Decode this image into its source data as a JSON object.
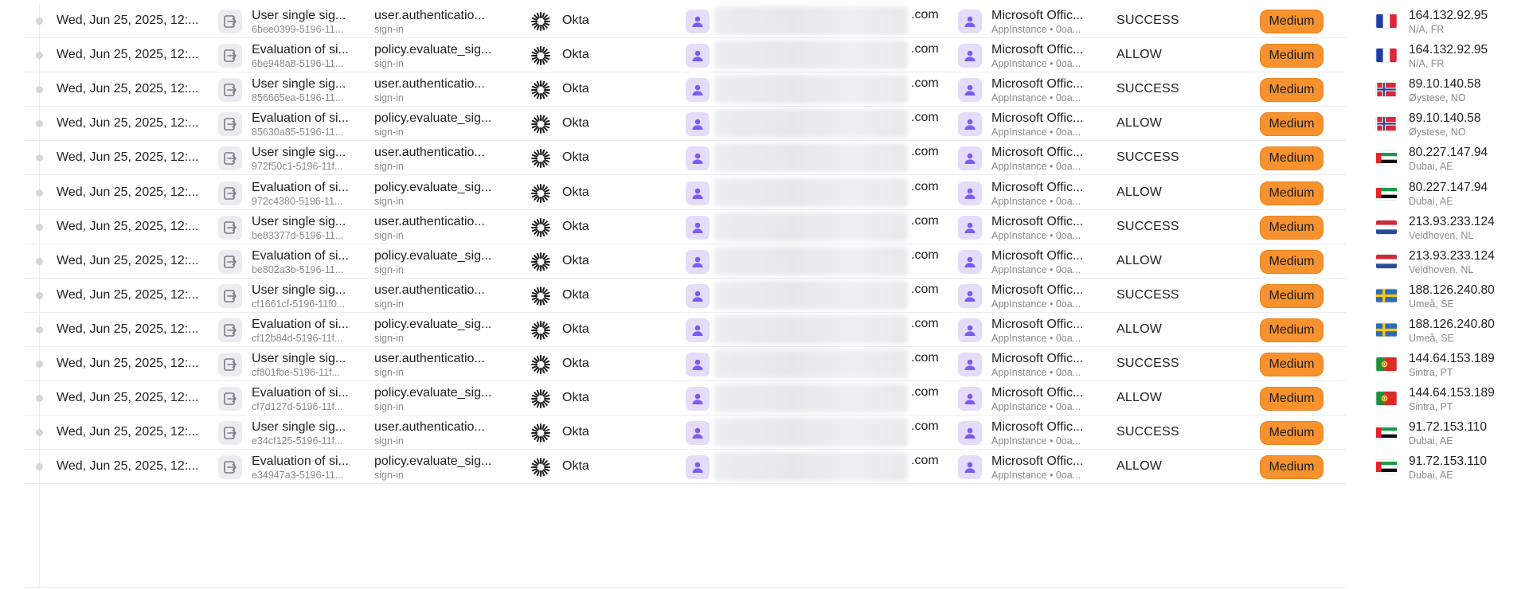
{
  "rows": [
    {
      "date": "Wed, Jun 25, 2025, 12:...",
      "event": "User single sig...",
      "event_id": "6bee0399-5196-11...",
      "type": "user.authenticatio...",
      "type_sub": "sign-in",
      "source": "Okta",
      "email_suffix": ".com",
      "app": "Microsoft Offic...",
      "app_sub": "AppInstance • 0oa...",
      "result": "SUCCESS",
      "severity": "Medium",
      "flag": "FR",
      "ip": "164.132.92.95",
      "location": "N/A, FR"
    },
    {
      "date": "Wed, Jun 25, 2025, 12:...",
      "event": "Evaluation of si...",
      "event_id": "6be948a8-5196-11...",
      "type": "policy.evaluate_sig...",
      "type_sub": "sign-in",
      "source": "Okta",
      "email_suffix": ".com",
      "app": "Microsoft Offic...",
      "app_sub": "AppInstance • 0oa...",
      "result": "ALLOW",
      "severity": "Medium",
      "flag": "FR",
      "ip": "164.132.92.95",
      "location": "N/A, FR"
    },
    {
      "date": "Wed, Jun 25, 2025, 12:...",
      "event": "User single sig...",
      "event_id": "856665ea-5196-11...",
      "type": "user.authenticatio...",
      "type_sub": "sign-in",
      "source": "Okta",
      "email_suffix": ".com",
      "app": "Microsoft Offic...",
      "app_sub": "AppInstance • 0oa...",
      "result": "SUCCESS",
      "severity": "Medium",
      "flag": "NO",
      "ip": "89.10.140.58",
      "location": "Øystese, NO"
    },
    {
      "date": "Wed, Jun 25, 2025, 12:...",
      "event": "Evaluation of si...",
      "event_id": "85630a85-5196-11...",
      "type": "policy.evaluate_sig...",
      "type_sub": "sign-in",
      "source": "Okta",
      "email_suffix": ".com",
      "app": "Microsoft Offic...",
      "app_sub": "AppInstance • 0oa...",
      "result": "ALLOW",
      "severity": "Medium",
      "flag": "NO",
      "ip": "89.10.140.58",
      "location": "Øystese, NO"
    },
    {
      "date": "Wed, Jun 25, 2025, 12:...",
      "event": "User single sig...",
      "event_id": "972f50c1-5196-11f...",
      "type": "user.authenticatio...",
      "type_sub": "sign-in",
      "source": "Okta",
      "email_suffix": ".com",
      "app": "Microsoft Offic...",
      "app_sub": "AppInstance • 0oa...",
      "result": "SUCCESS",
      "severity": "Medium",
      "flag": "AE",
      "ip": "80.227.147.94",
      "location": "Dubai, AE"
    },
    {
      "date": "Wed, Jun 25, 2025, 12:...",
      "event": "Evaluation of si...",
      "event_id": "972c4380-5196-11...",
      "type": "policy.evaluate_sig...",
      "type_sub": "sign-in",
      "source": "Okta",
      "email_suffix": ".com",
      "app": "Microsoft Offic...",
      "app_sub": "AppInstance • 0oa...",
      "result": "ALLOW",
      "severity": "Medium",
      "flag": "AE",
      "ip": "80.227.147.94",
      "location": "Dubai, AE"
    },
    {
      "date": "Wed, Jun 25, 2025, 12:...",
      "event": "User single sig...",
      "event_id": "be83377d-5196-11...",
      "type": "user.authenticatio...",
      "type_sub": "sign-in",
      "source": "Okta",
      "email_suffix": ".com",
      "app": "Microsoft Offic...",
      "app_sub": "AppInstance • 0oa...",
      "result": "SUCCESS",
      "severity": "Medium",
      "flag": "NL",
      "ip": "213.93.233.124",
      "location": "Veldhoven, NL"
    },
    {
      "date": "Wed, Jun 25, 2025, 12:...",
      "event": "Evaluation of si...",
      "event_id": "be802a3b-5196-11...",
      "type": "policy.evaluate_sig...",
      "type_sub": "sign-in",
      "source": "Okta",
      "email_suffix": ".com",
      "app": "Microsoft Offic...",
      "app_sub": "AppInstance • 0oa...",
      "result": "ALLOW",
      "severity": "Medium",
      "flag": "NL",
      "ip": "213.93.233.124",
      "location": "Veldhoven, NL"
    },
    {
      "date": "Wed, Jun 25, 2025, 12:...",
      "event": "User single sig...",
      "event_id": "cf1661cf-5196-11f0...",
      "type": "user.authenticatio...",
      "type_sub": "sign-in",
      "source": "Okta",
      "email_suffix": ".com",
      "app": "Microsoft Offic...",
      "app_sub": "AppInstance • 0oa...",
      "result": "SUCCESS",
      "severity": "Medium",
      "flag": "SE",
      "ip": "188.126.240.80",
      "location": "Umeå, SE"
    },
    {
      "date": "Wed, Jun 25, 2025, 12:...",
      "event": "Evaluation of si...",
      "event_id": "cf12b84d-5196-11f...",
      "type": "policy.evaluate_sig...",
      "type_sub": "sign-in",
      "source": "Okta",
      "email_suffix": ".com",
      "app": "Microsoft Offic...",
      "app_sub": "AppInstance • 0oa...",
      "result": "ALLOW",
      "severity": "Medium",
      "flag": "SE",
      "ip": "188.126.240.80",
      "location": "Umeå, SE"
    },
    {
      "date": "Wed, Jun 25, 2025, 12:...",
      "event": "User single sig...",
      "event_id": "cf801fbe-5196-11f...",
      "type": "user.authenticatio...",
      "type_sub": "sign-in",
      "source": "Okta",
      "email_suffix": ".com",
      "app": "Microsoft Offic...",
      "app_sub": "AppInstance • 0oa...",
      "result": "SUCCESS",
      "severity": "Medium",
      "flag": "PT",
      "ip": "144.64.153.189",
      "location": "Sintra, PT"
    },
    {
      "date": "Wed, Jun 25, 2025, 12:...",
      "event": "Evaluation of si...",
      "event_id": "cf7d127d-5196-11f...",
      "type": "policy.evaluate_sig...",
      "type_sub": "sign-in",
      "source": "Okta",
      "email_suffix": ".com",
      "app": "Microsoft Offic...",
      "app_sub": "AppInstance • 0oa...",
      "result": "ALLOW",
      "severity": "Medium",
      "flag": "PT",
      "ip": "144.64.153.189",
      "location": "Sintra, PT"
    },
    {
      "date": "Wed, Jun 25, 2025, 12:...",
      "event": "User single sig...",
      "event_id": "e34cf125-5196-11f...",
      "type": "user.authenticatio...",
      "type_sub": "sign-in",
      "source": "Okta",
      "email_suffix": ".com",
      "app": "Microsoft Offic...",
      "app_sub": "AppInstance • 0oa...",
      "result": "SUCCESS",
      "severity": "Medium",
      "flag": "AE",
      "ip": "91.72.153.110",
      "location": "Dubai, AE"
    },
    {
      "date": "Wed, Jun 25, 2025, 12:...",
      "event": "Evaluation of si...",
      "event_id": "e34947a3-5196-11...",
      "type": "policy.evaluate_sig...",
      "type_sub": "sign-in",
      "source": "Okta",
      "email_suffix": ".com",
      "app": "Microsoft Offic...",
      "app_sub": "AppInstance • 0oa...",
      "result": "ALLOW",
      "severity": "Medium",
      "flag": "AE",
      "ip": "91.72.153.110",
      "location": "Dubai, AE"
    }
  ],
  "colors": {
    "severity_medium": "#f7922e",
    "avatar_bg": "#e5dcfa",
    "avatar_fg": "#7c5cf0",
    "icon_bg": "#ececf0"
  },
  "icons": {
    "event": "sign-in-arrow-icon",
    "source": "okta-logo-icon",
    "user": "user-avatar-icon",
    "app": "app-avatar-icon"
  }
}
